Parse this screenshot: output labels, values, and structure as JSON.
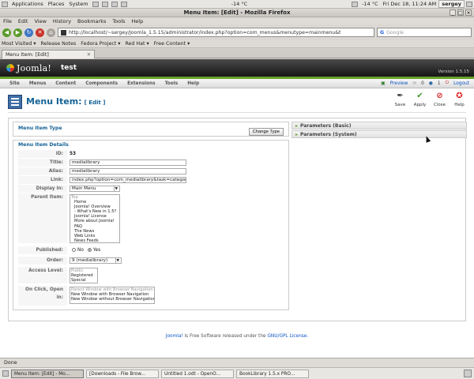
{
  "panel": {
    "applications": "Applications",
    "places": "Places",
    "system": "System",
    "temp_mid": "-14 °C",
    "temp_right": "-14 °C",
    "datetime": "Fri Dec 18, 11:24 AM",
    "user": "sergey"
  },
  "window": {
    "title": "Menu Item: [Edit] - Mozilla Firefox"
  },
  "menubar": [
    "File",
    "Edit",
    "View",
    "History",
    "Bookmarks",
    "Tools",
    "Help"
  ],
  "nav": {
    "url": "http://localhost/~sergey/Joomla_1.5.15/administrator/index.php?option=com_menus&menutype=mainmenu&t",
    "search_placeholder": "Google"
  },
  "bookmarks": [
    "Most Visited ▾",
    "Release Notes",
    "Fedora Project ▾",
    "Red Hat ▾",
    "Free Content ▾"
  ],
  "tab": {
    "label": "Menu Item: [Edit]"
  },
  "joomla": {
    "logo": "Joomla!",
    "site": "test",
    "version": "Version 1.5.15",
    "menu": [
      "Site",
      "Menus",
      "Content",
      "Components",
      "Extensions",
      "Tools",
      "Help"
    ],
    "preview": "Preview",
    "msg_count": "0",
    "users_count": "1",
    "logout": "Logout"
  },
  "page": {
    "title": "Menu Item:",
    "edit": "[ Edit ]",
    "toolbar": [
      "Save",
      "Apply",
      "Close",
      "Help"
    ]
  },
  "form": {
    "menu_item_type_legend": "Menu Item Type",
    "change_type": "Change Type",
    "details_legend": "Menu Item Details",
    "id_label": "ID:",
    "id_value": "53",
    "title_label": "Title:",
    "title_value": "medialibrary",
    "alias_label": "Alias:",
    "alias_value": "medialibrary",
    "link_label": "Link:",
    "link_value": "index.php?option=com_medialibrary&task=category",
    "display_label": "Display in:",
    "display_value": "Main Menu",
    "parent_label": "Parent Item:",
    "parent_options": [
      "Top",
      "Home",
      "Joomla! Overview",
      "- What's New in 1.5?",
      "Joomla! License",
      "More about Joomla!",
      "FAQ",
      "The News",
      "Web Links",
      "News Feeds"
    ],
    "published_label": "Published:",
    "published_no": "No",
    "published_yes": "Yes",
    "order_label": "Order:",
    "order_value": "9 (medialibrary)",
    "access_label": "Access Level:",
    "access_options": [
      "Public",
      "Registered",
      "Special"
    ],
    "onclick_label": "On Click, Open in:",
    "onclick_options": [
      "Parent Window with Browser Navigation",
      "New Window with Browser Navigation",
      "New Window without Browser Navigation"
    ]
  },
  "params": {
    "basic": "Parameters (Basic)",
    "system": "Parameters (System)"
  },
  "footer": {
    "link": "Joomla!",
    "text": "is Free Software released under the",
    "license": "GNU/GPL License."
  },
  "status": "Done",
  "taskbar": [
    "Menu Item: [Edit] - Mo...",
    "[Downloads - File Brow...",
    "Untitled 1.odt - OpenO...",
    "BookLibrary 1.5.x PRO..."
  ]
}
